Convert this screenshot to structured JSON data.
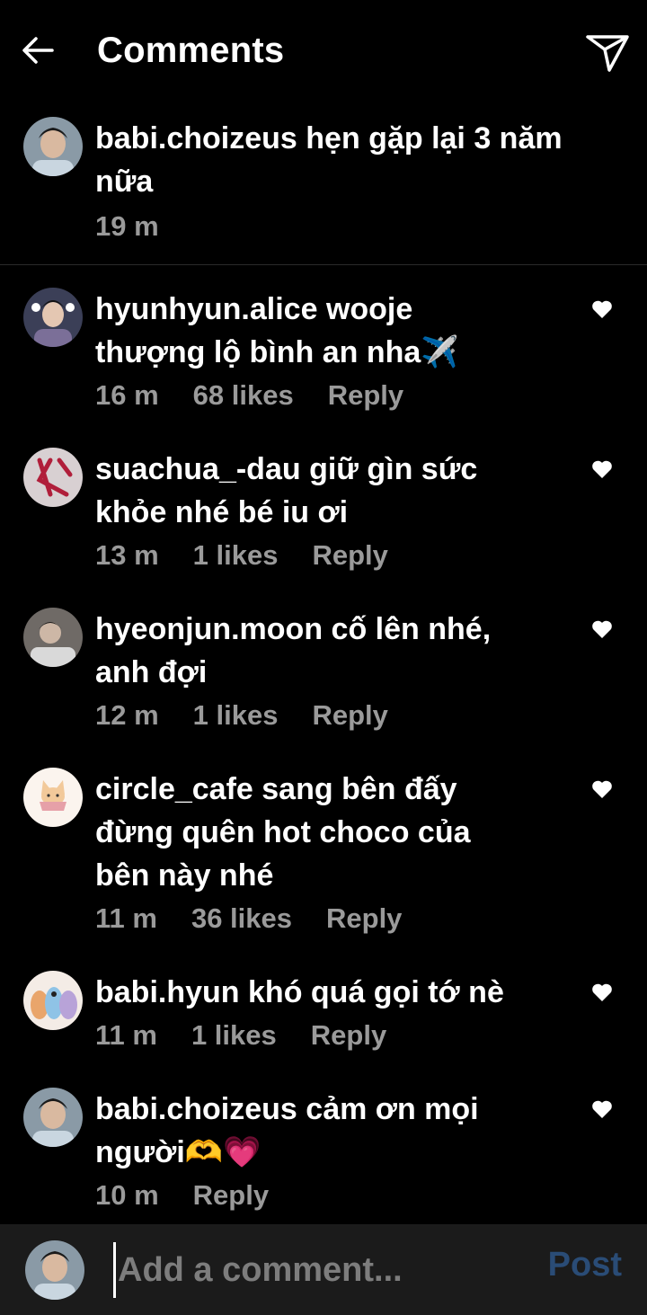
{
  "header": {
    "title": "Comments"
  },
  "caption": {
    "username": "babi.choizeus",
    "text_line1": "hẹn gặp lại 3 năm",
    "text_line2": "nữa",
    "time": "19 m"
  },
  "comments": [
    {
      "username": "hyunhyun.alice",
      "line1": "wooje",
      "line2": "thượng lộ bình an nha✈️",
      "line3": "",
      "time": "16 m",
      "likes": "68 likes",
      "reply": "Reply"
    },
    {
      "username": "suachua_-dau",
      "line1": "giữ gìn sức",
      "line2": "khỏe nhé bé iu ơi",
      "line3": "",
      "time": "13 m",
      "likes": "1 likes",
      "reply": "Reply"
    },
    {
      "username": "hyeonjun.moon",
      "line1": "cố lên nhé,",
      "line2": "anh đợi",
      "line3": "",
      "time": "12 m",
      "likes": "1 likes",
      "reply": "Reply"
    },
    {
      "username": "circle_cafe",
      "line1": "sang bên đấy",
      "line2": "đừng quên hot choco của",
      "line3": "bên này nhé",
      "time": "11 m",
      "likes": "36 likes",
      "reply": "Reply"
    },
    {
      "username": "babi.hyun",
      "line1": "khó quá gọi tớ nè",
      "line2": "",
      "line3": "",
      "time": "11 m",
      "likes": "1 likes",
      "reply": "Reply"
    },
    {
      "username": "babi.choizeus",
      "line1": "cảm ơn mọi",
      "line2": "người🫶💗",
      "line3": "",
      "time": "10 m",
      "likes": "",
      "reply": "Reply"
    }
  ],
  "composer": {
    "placeholder": "Add a comment...",
    "post_label": "Post"
  },
  "colors": {
    "background": "#000000",
    "muted": "#9a9a9a",
    "post_disabled": "#2a4c76",
    "composer_bg": "#1b1b1b"
  },
  "icons": [
    "back-arrow-icon",
    "send-icon",
    "heart-icon"
  ]
}
